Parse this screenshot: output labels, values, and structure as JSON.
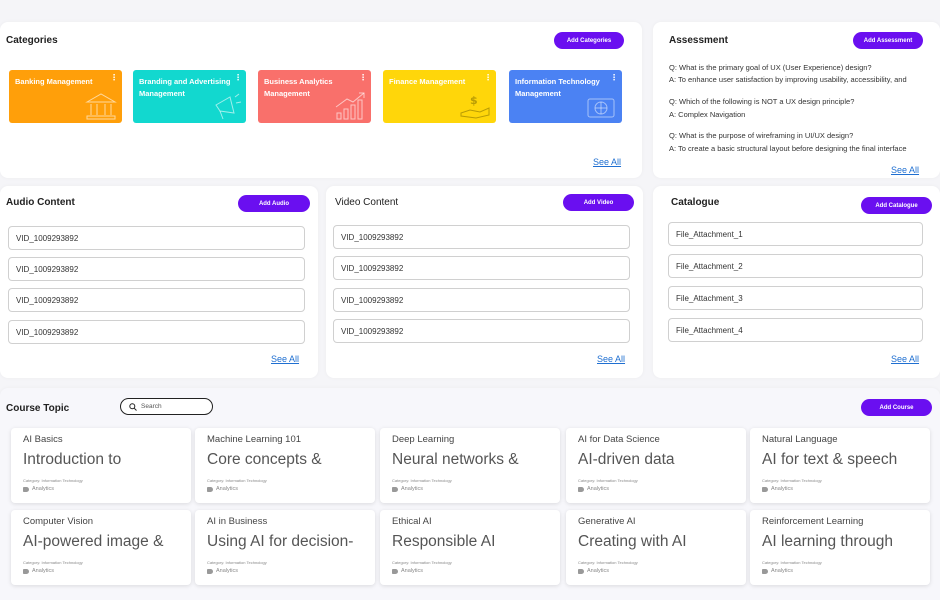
{
  "categories": {
    "title": "Categories",
    "add_label": "Add Categories",
    "see_all": "See All",
    "items": [
      {
        "label": "Banking Management",
        "icon": "bank-icon",
        "color": "#ff9f0a"
      },
      {
        "label": "Branding and Advertising Management",
        "icon": "megaphone-icon",
        "color": "#12d8cf"
      },
      {
        "label": "Business Analytics Management",
        "icon": "growth-chart-icon",
        "color": "#f9706b"
      },
      {
        "label": "Finance Management",
        "icon": "money-hand-icon",
        "color": "#ffd60a"
      },
      {
        "label": "Information Technology Management",
        "icon": "tech-globe-icon",
        "color": "#4b82f3"
      }
    ]
  },
  "assessment": {
    "title": "Assessment",
    "add_label": "Add Assessment",
    "see_all": "See All",
    "items": [
      {
        "q": "Q: What is the primary goal of UX (User Experience) design?",
        "a": "A: To enhance user satisfaction by improving usability, accessibility, and"
      },
      {
        "q": "Q: Which of the following is NOT a UX design principle?",
        "a": "A: Complex Navigation"
      },
      {
        "q": "Q: What is the purpose of wireframing in UI/UX design?",
        "a": "A: To create a basic structural layout before designing the final interface"
      }
    ]
  },
  "audio": {
    "title": "Audio Content",
    "add_label": "Add Audio",
    "see_all": "See All",
    "items": [
      "VID_1009293892",
      "VID_1009293892",
      "VID_1009293892",
      "VID_1009293892"
    ]
  },
  "video": {
    "title": "Video Content",
    "add_label": "Add Video",
    "see_all": "See All",
    "items": [
      "VID_1009293892",
      "VID_1009293892",
      "VID_1009293892",
      "VID_1009293892"
    ]
  },
  "catalogue": {
    "title": "Catalogue",
    "add_label": "Add Catalogue",
    "see_all": "See All",
    "items": [
      "File_Attachment_1",
      "File_Attachment_2",
      "File_Attachment_3",
      "File_Attachment_4"
    ]
  },
  "course_topic": {
    "title": "Course Topic",
    "search_placeholder": "Search",
    "add_label": "Add Course",
    "courses": [
      {
        "title": "AI Basics",
        "desc": "Introduction to",
        "category": "Category: Information Technology",
        "tag": "Analytics"
      },
      {
        "title": "Machine Learning 101",
        "desc": "Core concepts &",
        "category": "Category: Information Technology",
        "tag": "Analytics"
      },
      {
        "title": "Deep Learning",
        "desc": "Neural networks &",
        "category": "Category: Information Technology",
        "tag": "Analytics"
      },
      {
        "title": "AI for Data Science",
        "desc": "AI-driven data",
        "category": "Category: Information Technology",
        "tag": "Analytics"
      },
      {
        "title": "Natural Language",
        "desc": "AI for text & speech",
        "category": "Category: Information Technology",
        "tag": "Analytics"
      },
      {
        "title": "Computer Vision",
        "desc": "AI-powered image &",
        "category": "Category: Information Technology",
        "tag": "Analytics"
      },
      {
        "title": "AI in Business",
        "desc": "Using AI for decision-",
        "category": "Category: Information Technology",
        "tag": "Analytics"
      },
      {
        "title": "Ethical AI",
        "desc": "Responsible AI",
        "category": "Category: Information Technology",
        "tag": "Analytics"
      },
      {
        "title": "Generative AI",
        "desc": "Creating with AI",
        "category": "Category: Information Technology",
        "tag": "Analytics"
      },
      {
        "title": "Reinforcement Learning",
        "desc": "AI learning through",
        "category": "Category: Information Technology",
        "tag": "Analytics"
      }
    ]
  }
}
